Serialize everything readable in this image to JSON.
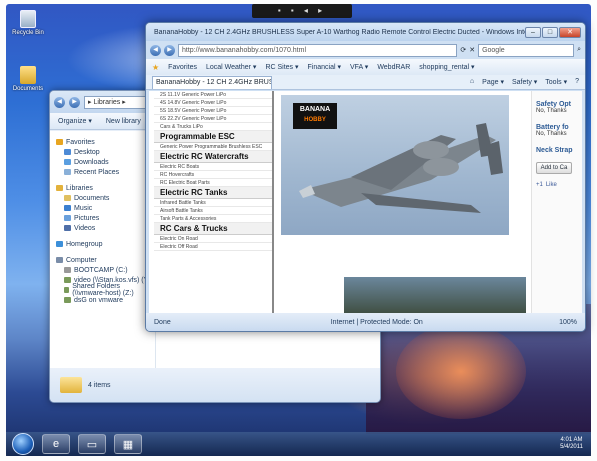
{
  "desktop": {
    "icons": [
      {
        "label": "Recycle Bin",
        "icon": "recycle-bin-icon"
      },
      {
        "label": "Documents",
        "icon": "documents-folder-icon"
      }
    ],
    "top_bar_label": "▪ ▪ ◂ ▸"
  },
  "explorer": {
    "path": "▸ Libraries ▸",
    "toolbar": {
      "organize": "Organize ▾",
      "new_library": "New library"
    },
    "favorites_header": "Favorites",
    "favorites": [
      "Desktop",
      "Downloads",
      "Recent Places"
    ],
    "libraries_header": "Libraries",
    "libraries": [
      "Documents",
      "Music",
      "Pictures",
      "Videos"
    ],
    "homegroup": "Homegroup",
    "computer_header": "Computer",
    "drives": [
      "BOOTCAMP (C:)",
      "video (\\\\Stan.kos.vfs) (Y:)",
      "Shared Folders (\\\\vmware-host) (Z:)",
      "dsG on vmware"
    ],
    "status": "4 items"
  },
  "ie": {
    "title": "BananaHobby - 12 CH 2.4GHz BRUSHLESS Super A-10 Warthog Radio Remote Control Electric Ducted - Windows Internet Explorer",
    "url": "http://www.bananahobby.com/1070.html",
    "search_placeholder": "Google",
    "favorites_bar": [
      "Favorites",
      "Local Weather ▾",
      "RC Sites ▾",
      "Financial ▾",
      "VFA ▾",
      "WebdRAR",
      "shopping_rental ▾"
    ],
    "tab": "BananaHobby - 12 CH 2.4GHz BRUSHLESS Super...",
    "command_bar": [
      "Page ▾",
      "Safety ▾",
      "Tools ▾"
    ],
    "status_left": "Done",
    "status_zone": "Internet | Protected Mode: On",
    "zoom": "100%"
  },
  "page": {
    "categories": [
      {
        "type": "item",
        "text": "2S 11.1V Generic Power LiPo"
      },
      {
        "type": "item",
        "text": "4S 14.8V Generic Power LiPo"
      },
      {
        "type": "item",
        "text": "5S 18.5V Generic Power LiPo"
      },
      {
        "type": "item",
        "text": "6S 22.2V Generic Power LiPo"
      },
      {
        "type": "item",
        "text": "Cars & Trucks LiPo"
      },
      {
        "type": "head",
        "text": "Programmable ESC"
      },
      {
        "type": "item",
        "text": "Generic Power Programmable Brushless ESC"
      },
      {
        "type": "head",
        "text": "Electric RC Watercrafts"
      },
      {
        "type": "item",
        "text": "Electric RC Boats"
      },
      {
        "type": "item",
        "text": "RC Hovercrafts"
      },
      {
        "type": "item",
        "text": "RC Electric Boat Parts"
      },
      {
        "type": "head",
        "text": "Electric RC Tanks"
      },
      {
        "type": "item",
        "text": "Infrared Battle Tanks"
      },
      {
        "type": "item",
        "text": "Airsoft Battle Tanks"
      },
      {
        "type": "item",
        "text": "Tank Parts & Accessories"
      },
      {
        "type": "head",
        "text": "RC Cars & Trucks"
      },
      {
        "type": "item",
        "text": "Electric On Road"
      },
      {
        "type": "item",
        "text": "Electric Off Road"
      }
    ],
    "logo_text": "BANANA",
    "logo_sub": "HOBBY",
    "side": {
      "safety_label": "Safety Opt",
      "safety_value": "No, Thanks",
      "battery_label": "Battery fo",
      "battery_value": "No, Thanks",
      "neck_label": "Neck Strap",
      "cart_button": "Add to Ca",
      "social": [
        "+1",
        "Like"
      ]
    }
  },
  "taskbar": {
    "items": [
      "ie-icon",
      "folder-icon",
      "window-icon"
    ],
    "clock_time": "4:01 AM",
    "clock_date": "5/4/2011"
  }
}
